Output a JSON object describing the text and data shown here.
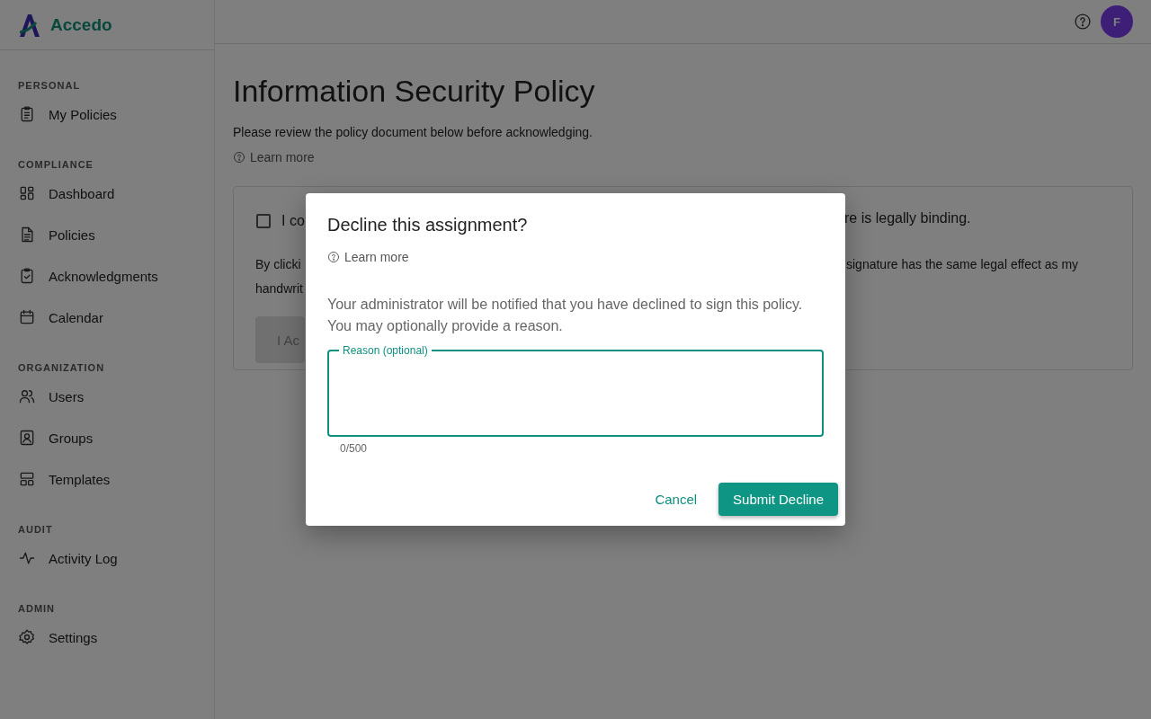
{
  "app": {
    "name": "Accedo"
  },
  "sidebar": {
    "sections": [
      {
        "heading": "PERSONAL",
        "items": [
          {
            "label": "My Policies"
          }
        ]
      },
      {
        "heading": "COMPLIANCE",
        "items": [
          {
            "label": "Dashboard"
          },
          {
            "label": "Policies"
          },
          {
            "label": "Acknowledgments"
          },
          {
            "label": "Calendar"
          }
        ]
      },
      {
        "heading": "ORGANIZATION",
        "items": [
          {
            "label": "Users"
          },
          {
            "label": "Groups"
          },
          {
            "label": "Templates"
          }
        ]
      },
      {
        "heading": "AUDIT",
        "items": [
          {
            "label": "Activity Log"
          }
        ]
      },
      {
        "heading": "ADMIN",
        "items": [
          {
            "label": "Settings"
          }
        ]
      }
    ]
  },
  "topbar": {
    "avatar": "F"
  },
  "page": {
    "title": "Information Security Policy",
    "subtitle": "Please review the policy document below before acknowledging.",
    "learn_more": "Learn more",
    "card": {
      "checkbox": {
        "checked": false,
        "label_start": "I co",
        "label_end": "re is legally binding."
      },
      "note_line_1_start": "By clicki",
      "note_line_1_end": "signature has the same legal effect as my",
      "note_line_2_start": "handwrit",
      "button": {
        "label": "I Ac",
        "disabled": true
      }
    }
  },
  "dialog": {
    "title": "Decline this assignment?",
    "learn_more": "Learn more",
    "message": "Your administrator will be notified that you have declined to sign this policy. You may optionally provide a reason.",
    "reason_field": {
      "label": "Reason (optional)",
      "focused": true,
      "counter": "0/500"
    },
    "buttons": [
      {
        "kind": "text",
        "label": "Cancel"
      },
      {
        "kind": "primary",
        "label": "Submit Decline"
      }
    ]
  }
}
